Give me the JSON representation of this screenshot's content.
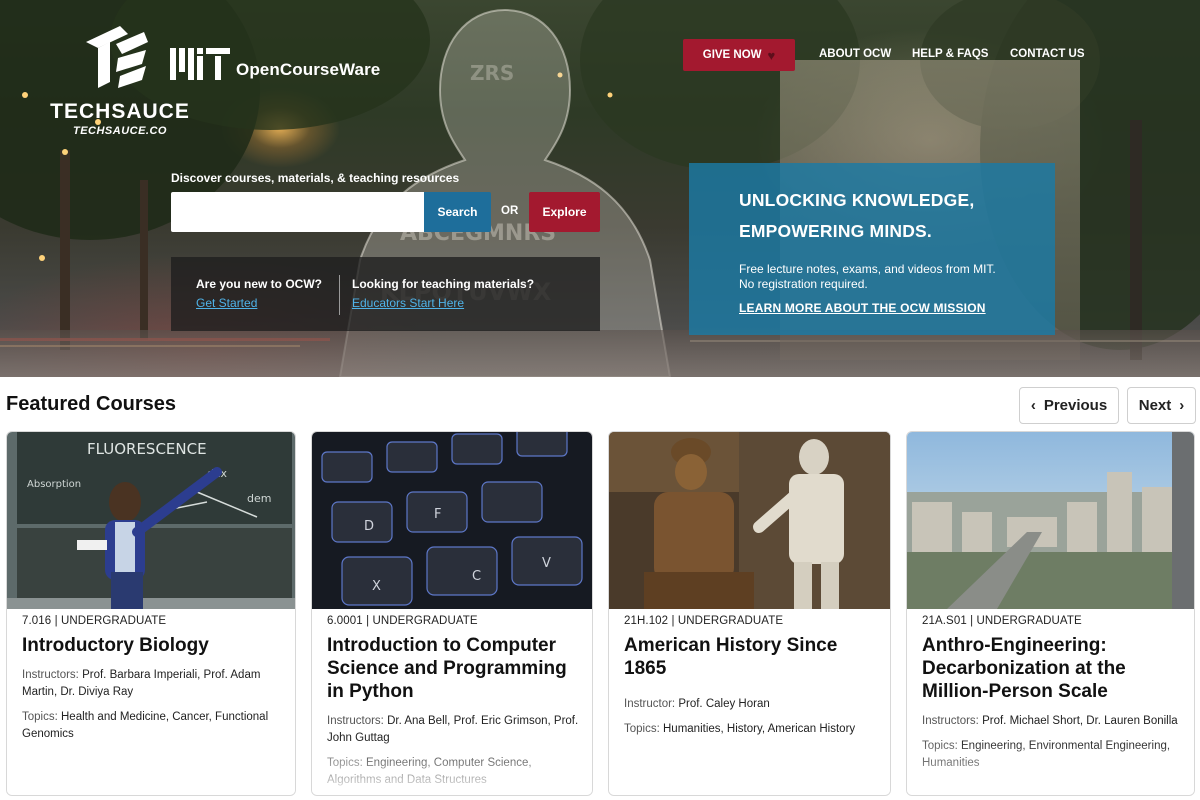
{
  "brand": {
    "techsauce_name": "TECHSAUCE",
    "techsauce_url": "TECHSAUCE.CO",
    "mit_wordmark": "MIT",
    "ocw_name": "OpenCourseWare"
  },
  "nav": {
    "give_now": "GIVE NOW",
    "give_icon": "heart-icon",
    "links": [
      "ABOUT OCW",
      "HELP & FAQS",
      "CONTACT US"
    ]
  },
  "search": {
    "label": "Discover courses, materials, & teaching resources",
    "value": "",
    "placeholder": "",
    "button": "Search",
    "or": "OR",
    "explore": "Explore"
  },
  "info": {
    "new_question": "Are you new to OCW?",
    "new_link": "Get Started",
    "educator_question": "Looking for teaching materials?",
    "educator_link": "Educators Start Here"
  },
  "mission": {
    "title_line1": "UNLOCKING KNOWLEDGE,",
    "title_line2": "EMPOWERING MINDS.",
    "desc_line1": "Free lecture notes, exams, and videos from MIT.",
    "desc_line2": "No registration required.",
    "link": "LEARN MORE ABOUT THE OCW MISSION"
  },
  "featured": {
    "title": "Featured Courses",
    "previous": "Previous",
    "next": "Next",
    "cards": [
      {
        "code": "7.016 | UNDERGRADUATE",
        "title": "Introductory Biology",
        "instructors_label": "Instructors:",
        "instructors": "Prof. Barbara Imperiali, Prof. Adam Martin, Dr. Diviya Ray",
        "topics_label": "Topics:",
        "topics": "Health and Medicine, Cancer, Functional Genomics"
      },
      {
        "code": "6.0001 | UNDERGRADUATE",
        "title": "Introduction to Computer Science and Programming in Python",
        "instructors_label": "Instructors:",
        "instructors": "Dr. Ana Bell, Prof. Eric Grimson, Prof. John Guttag",
        "topics_label": "Topics:",
        "topics": "Engineering, Computer Science, Algorithms and Data Structures"
      },
      {
        "code": "21H.102 | UNDERGRADUATE",
        "title": "American History Since 1865",
        "instructors_label": "Instructor:",
        "instructors": "Prof. Caley Horan",
        "topics_label": "Topics:",
        "topics": "Humanities, History, American History"
      },
      {
        "code": "21A.S01 | UNDERGRADUATE",
        "title": "Anthro-Engineering: Decarbonization at the Million-Person Scale",
        "instructors_label": "Instructors:",
        "instructors": "Prof. Michael Short, Dr. Lauren Bonilla",
        "topics_label": "Topics:",
        "topics": "Engineering, Environmental Engineering, Humanities"
      }
    ]
  },
  "colors": {
    "accent_red": "#a3192f",
    "accent_blue": "#1e6e9b",
    "mission_blue": "#1b7aa5",
    "link_blue": "#4fb3e8"
  }
}
